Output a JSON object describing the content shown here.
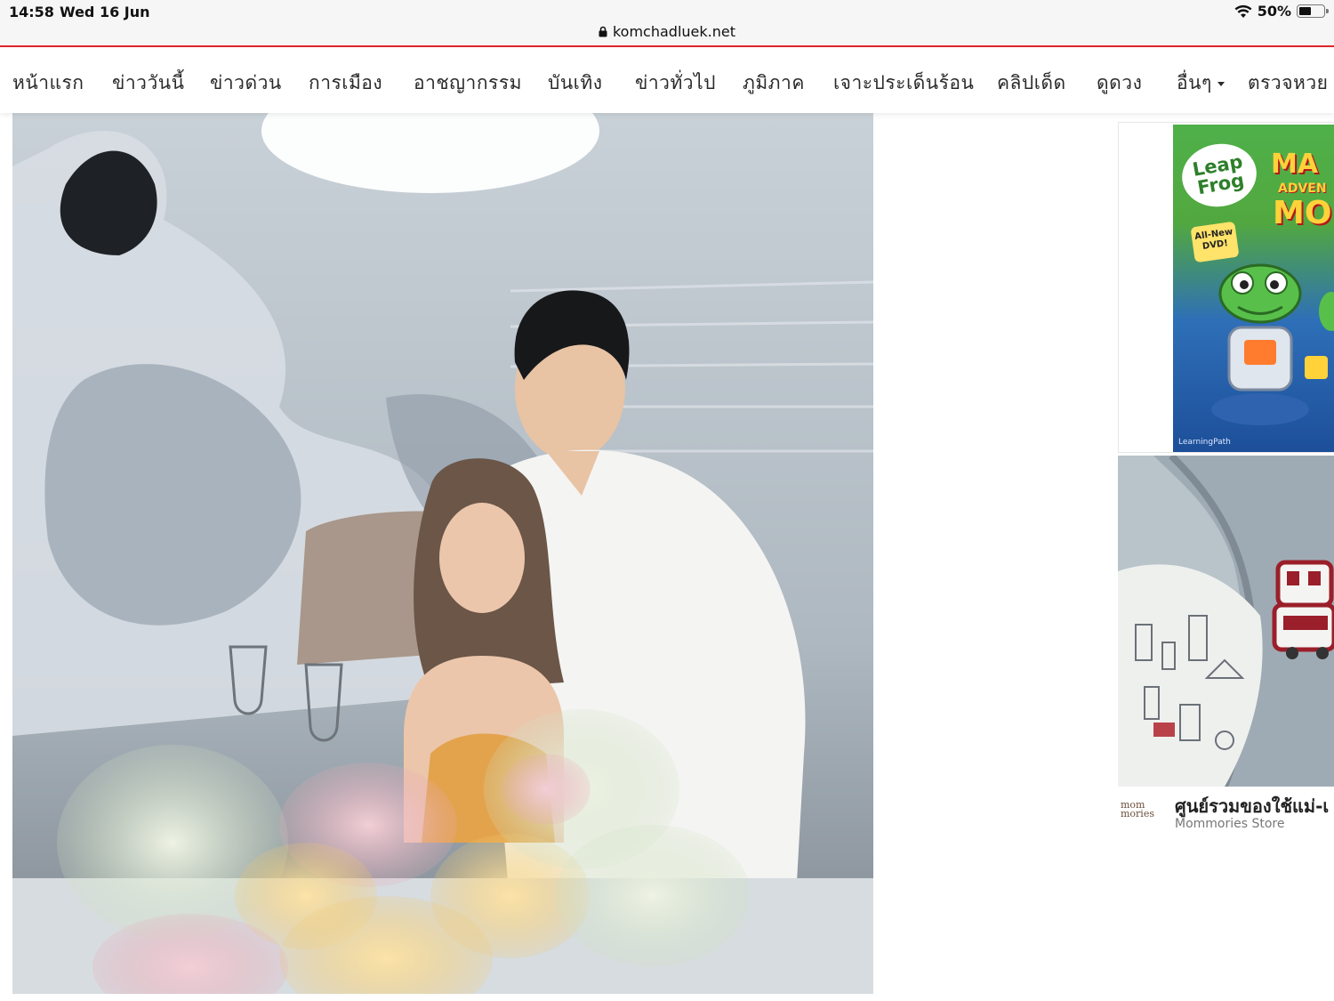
{
  "status_bar": {
    "time": "14:58",
    "date": "Wed 16 Jun",
    "battery": "50%",
    "battery_level": 0.5,
    "url": "komchadluek.net"
  },
  "nav": {
    "items": [
      {
        "label": "หน้าแรก"
      },
      {
        "label": "ข่าววันนี้"
      },
      {
        "label": "ข่าวด่วน"
      },
      {
        "label": "การเมือง"
      },
      {
        "label": "อาชญากรรม"
      },
      {
        "label": "บันเทิง"
      },
      {
        "label": "ข่าวทั่วไป"
      },
      {
        "label": "ภูมิภาค"
      },
      {
        "label": "เจาะประเด็นร้อน"
      },
      {
        "label": "คลิปเด็ด"
      },
      {
        "label": "ดูดวง"
      },
      {
        "label": "อื่นๆ"
      },
      {
        "label": "ตรวจหวย"
      }
    ],
    "accent_color": "#e0262c"
  },
  "ad_leapfrog": {
    "logo": "Leap Frog",
    "badge": "All-New DVD!",
    "title_line1": "MA",
    "title_line2": "ADVEN",
    "title_line3": "MO",
    "footer": "LearningPath"
  },
  "ad_mommories": {
    "logo": "mom mories",
    "title": "ศูนย์รวมของใช้แม่-เ",
    "store": "Mommories Store"
  }
}
